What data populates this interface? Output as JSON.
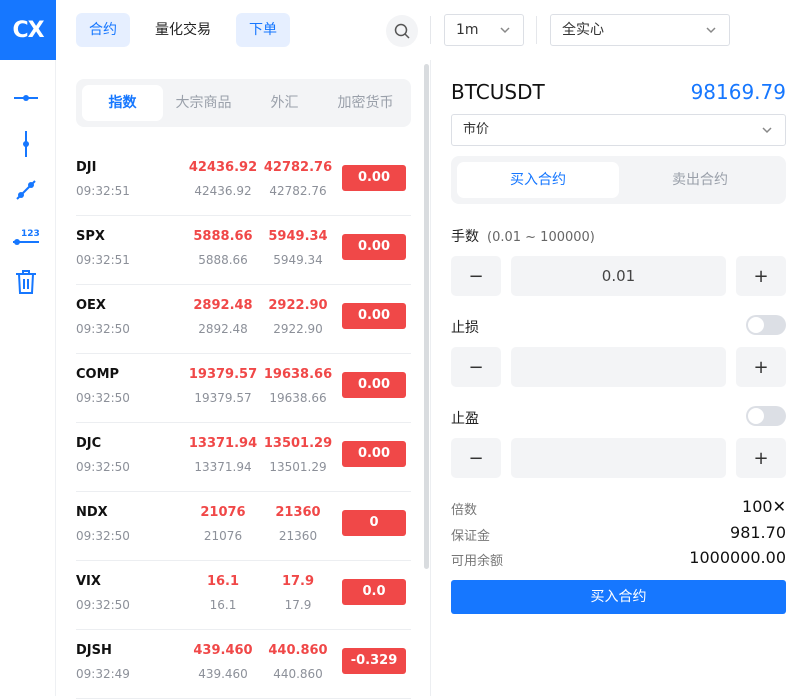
{
  "brand": {
    "logo_text": "CX"
  },
  "toolbar": {
    "tools": [
      {
        "name": "horizontal-line-tool-icon"
      },
      {
        "name": "vertical-line-tool-icon"
      },
      {
        "name": "trend-line-tool-icon"
      },
      {
        "name": "price-label-tool-icon",
        "label": "123"
      },
      {
        "name": "delete-drawings-icon"
      }
    ]
  },
  "topbar": {
    "tabs": [
      {
        "label": "合约",
        "active": true
      },
      {
        "label": "量化交易",
        "active": false
      },
      {
        "label": "下单",
        "active": true
      }
    ],
    "interval": "1m",
    "margin_mode": "全实心"
  },
  "watchlist": {
    "categories": [
      {
        "label": "指数",
        "active": true
      },
      {
        "label": "大宗商品",
        "active": false
      },
      {
        "label": "外汇",
        "active": false
      },
      {
        "label": "加密货币",
        "active": false
      }
    ],
    "rows": [
      {
        "symbol": "DJI",
        "time": "09:32:51",
        "price1": "42436.92",
        "price2": "42782.76",
        "sub1": "42436.92",
        "sub2": "42782.76",
        "change": "0.00"
      },
      {
        "symbol": "SPX",
        "time": "09:32:51",
        "price1": "5888.66",
        "price2": "5949.34",
        "sub1": "5888.66",
        "sub2": "5949.34",
        "change": "0.00"
      },
      {
        "symbol": "OEX",
        "time": "09:32:50",
        "price1": "2892.48",
        "price2": "2922.90",
        "sub1": "2892.48",
        "sub2": "2922.90",
        "change": "0.00"
      },
      {
        "symbol": "COMP",
        "time": "09:32:50",
        "price1": "19379.57",
        "price2": "19638.66",
        "sub1": "19379.57",
        "sub2": "19638.66",
        "change": "0.00"
      },
      {
        "symbol": "DJC",
        "time": "09:32:50",
        "price1": "13371.94",
        "price2": "13501.29",
        "sub1": "13371.94",
        "sub2": "13501.29",
        "change": "0.00"
      },
      {
        "symbol": "NDX",
        "time": "09:32:50",
        "price1": "21076",
        "price2": "21360",
        "sub1": "21076",
        "sub2": "21360",
        "change": "0"
      },
      {
        "symbol": "VIX",
        "time": "09:32:50",
        "price1": "16.1",
        "price2": "17.9",
        "sub1": "16.1",
        "sub2": "17.9",
        "change": "0.0"
      },
      {
        "symbol": "DJSH",
        "time": "09:32:49",
        "price1": "439.460",
        "price2": "440.860",
        "sub1": "439.460",
        "sub2": "440.860",
        "change": "-0.329"
      }
    ]
  },
  "order": {
    "symbol": "BTCUSDT",
    "last_price": "98169.79",
    "order_type": "市价",
    "side_tabs": [
      {
        "label": "买入合约",
        "active": true
      },
      {
        "label": "卖出合约",
        "active": false
      }
    ],
    "quantity": {
      "label": "手数",
      "hint": "(0.01 ~ 100000)",
      "value": "0.01"
    },
    "stop_loss": {
      "label": "止损",
      "value": "",
      "enabled": false
    },
    "take_profit": {
      "label": "止盈",
      "value": "",
      "enabled": false
    },
    "stepper": {
      "minus": "−",
      "plus": "+"
    },
    "info": [
      {
        "label": "倍数",
        "value": "100✕"
      },
      {
        "label": "保证金",
        "value": "981.70"
      },
      {
        "label": "可用余额",
        "value": "1000000.00"
      }
    ],
    "submit_label": "买入合约"
  }
}
